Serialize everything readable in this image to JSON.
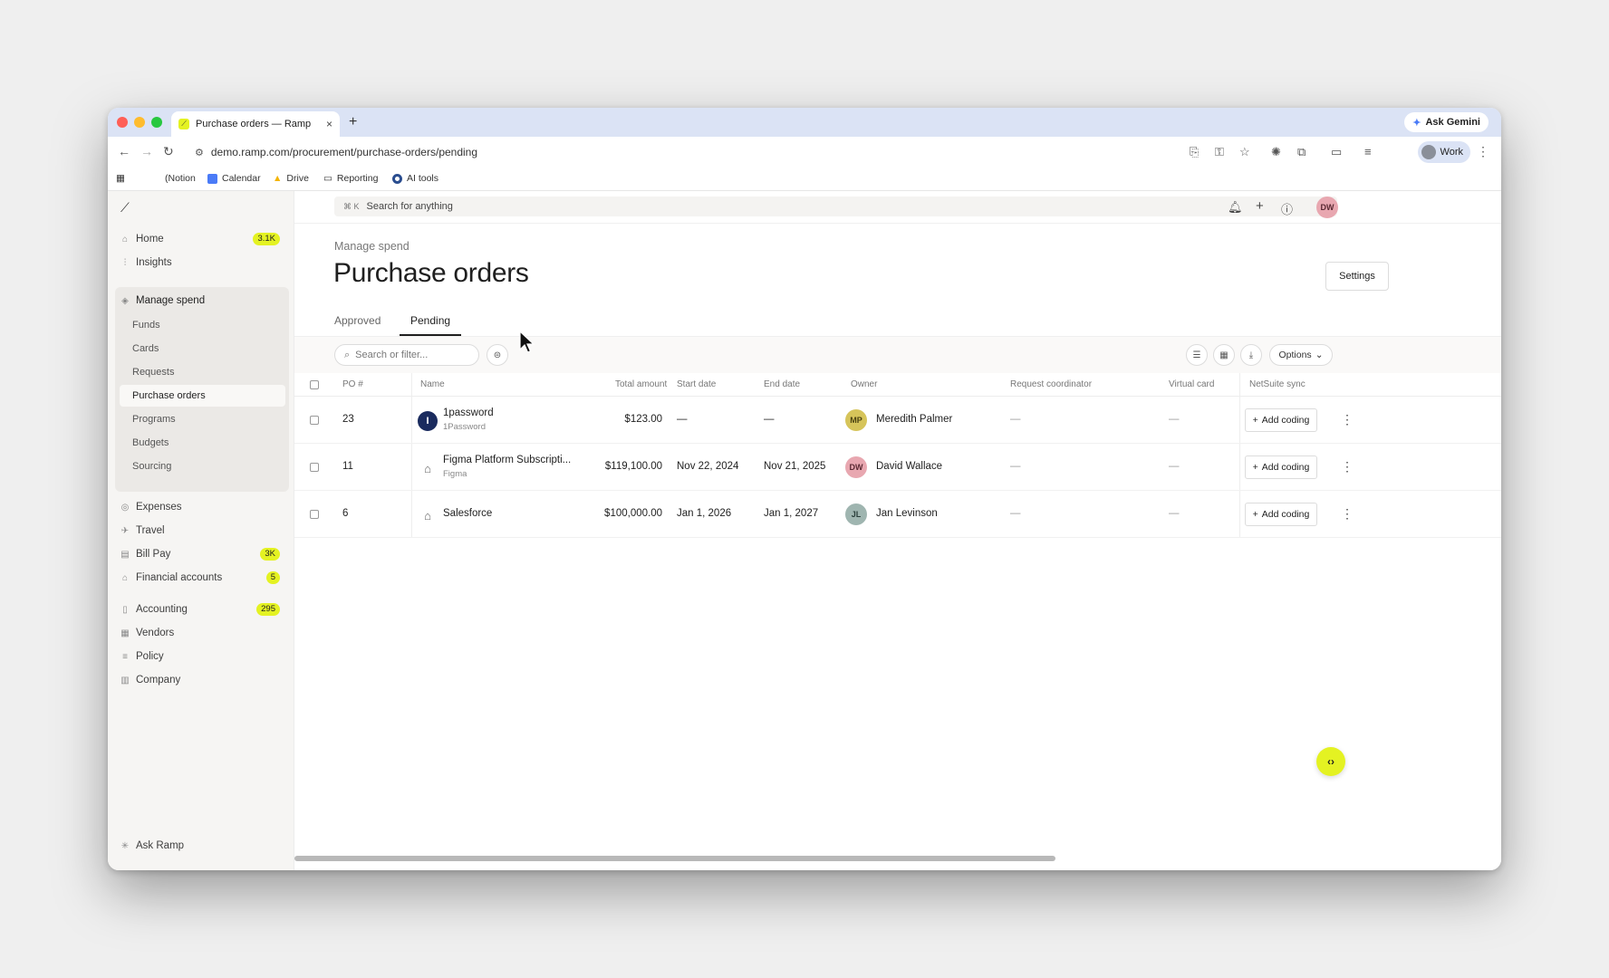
{
  "browser": {
    "tab_title": "Purchase orders — Ramp",
    "tab_close": "×",
    "new_tab": "+",
    "ask_gemini": "Ask Gemini",
    "url": "demo.ramp.com/procurement/purchase-orders/pending",
    "profile": "Work",
    "bookmarks": [
      "(Notion",
      "Calendar",
      "Drive",
      "Reporting",
      "AI tools"
    ]
  },
  "sidebar": {
    "items_top": [
      {
        "label": "Home",
        "icon": "home-icon",
        "badge": "3.1K"
      },
      {
        "label": "Insights",
        "icon": "chart-icon",
        "badge": ""
      }
    ],
    "group": {
      "label": "Manage spend",
      "items": [
        "Funds",
        "Cards",
        "Requests",
        "Purchase orders",
        "Programs",
        "Budgets",
        "Sourcing"
      ],
      "active": "Purchase orders"
    },
    "items_mid": [
      {
        "label": "Expenses",
        "badge": ""
      },
      {
        "label": "Travel",
        "badge": ""
      },
      {
        "label": "Bill Pay",
        "badge": "3K"
      },
      {
        "label": "Financial accounts",
        "badge": "5"
      }
    ],
    "items_bottom": [
      {
        "label": "Accounting",
        "badge": "295"
      },
      {
        "label": "Vendors",
        "badge": ""
      },
      {
        "label": "Policy",
        "badge": ""
      },
      {
        "label": "Company",
        "badge": ""
      }
    ],
    "ask_ramp": "Ask Ramp"
  },
  "topbar": {
    "search_shortcut": "⌘ K",
    "search_placeholder": "Search for anything",
    "user_initials": "DW"
  },
  "page": {
    "breadcrumb": "Manage spend",
    "title": "Purchase orders",
    "settings_label": "Settings",
    "tabs": [
      "Approved",
      "Pending"
    ],
    "active_tab": "Pending",
    "search_placeholder": "Search or filter...",
    "options_label": "Options"
  },
  "table": {
    "columns": [
      "PO #",
      "Name",
      "Total amount",
      "Start date",
      "End date",
      "Owner",
      "Request coordinator",
      "Virtual card",
      "NetSuite sync"
    ],
    "add_coding_label": "Add coding",
    "rows": [
      {
        "po": "23",
        "name": "1password",
        "sub": "1Password",
        "amount": "$123.00",
        "start": "—",
        "end": "—",
        "owner_initials": "MP",
        "owner": "Meredith Palmer",
        "owner_color": "#d6c45a",
        "coordinator": "—",
        "virtual_card": "—"
      },
      {
        "po": "11",
        "name": "Figma Platform Subscripti...",
        "sub": "Figma",
        "amount": "$119,100.00",
        "start": "Nov 22, 2024",
        "end": "Nov 21, 2025",
        "owner_initials": "DW",
        "owner": "David Wallace",
        "owner_color": "#e8a7b0",
        "coordinator": "—",
        "virtual_card": "—"
      },
      {
        "po": "6",
        "name": "Salesforce",
        "sub": "",
        "amount": "$100,000.00",
        "start": "Jan 1, 2026",
        "end": "Jan 1, 2027",
        "owner_initials": "JL",
        "owner": "Jan Levinson",
        "owner_color": "#9fb5b0",
        "coordinator": "—",
        "virtual_card": "—"
      }
    ]
  },
  "colors": {
    "accent": "#e4f222",
    "browser_chrome": "#dbe3f5"
  }
}
